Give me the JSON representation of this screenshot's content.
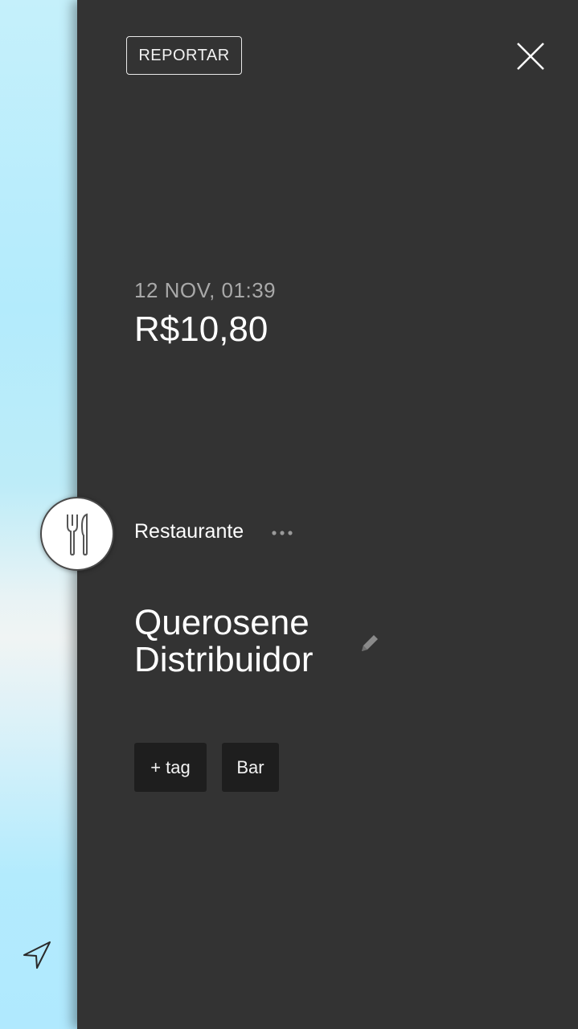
{
  "header": {
    "report_label": "REPORTAR"
  },
  "transaction": {
    "date": "12 NOV, 01:39",
    "amount": "R$10,80",
    "category": "Restaurante",
    "merchant_line1": "Querosene",
    "merchant_line2": "Distribuidor"
  },
  "tags": {
    "add_label": "+ tag",
    "items": [
      "Bar"
    ]
  },
  "icons": {
    "close": "close-icon",
    "category": "fork-knife-icon",
    "more": "more-dots-icon",
    "edit": "pencil-icon",
    "navigation": "location-arrow-icon"
  },
  "colors": {
    "panel_bg": "#333333",
    "tag_bg": "#1e1e1e",
    "text_primary": "#ffffff",
    "text_secondary": "#a9a9a9"
  }
}
